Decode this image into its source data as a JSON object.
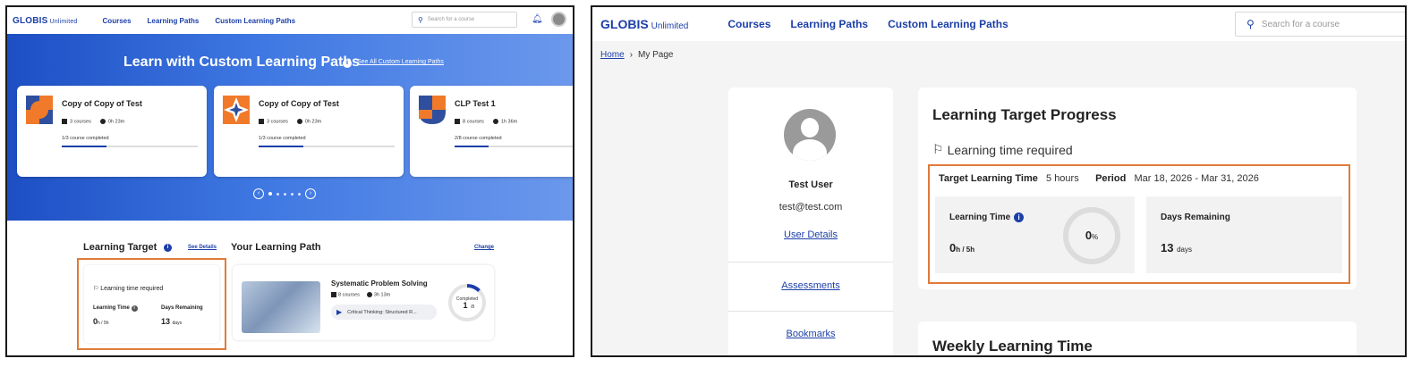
{
  "left": {
    "nav": {
      "logo": "GLOBIS",
      "logo_sub": "Unlimited",
      "links": [
        "Courses",
        "Learning Paths",
        "Custom Learning Paths"
      ],
      "search_placeholder": "Search for a course"
    },
    "hero": {
      "title": "Learn with Custom Learning Paths",
      "link": "See All Custom Learning Paths",
      "cards": [
        {
          "title": "Copy of Copy of Test",
          "courses": "3 courses",
          "time": "0h 23m",
          "completed": "1/3 course completed",
          "progress": 0.33
        },
        {
          "title": "Copy of Copy of Test",
          "courses": "3 courses",
          "time": "0h 23m",
          "completed": "1/3 course completed",
          "progress": 0.33
        },
        {
          "title": "CLP Test 1",
          "courses": "8 courses",
          "time": "1h 36m",
          "completed": "2/8 course completed",
          "progress": 0.25
        }
      ]
    },
    "learning_target": {
      "title": "Learning Target",
      "see_details": "See Details",
      "required": "Learning time required",
      "learning_time_label": "Learning Time",
      "learning_time_value": "0",
      "learning_time_unit": "h / 5h",
      "days_label": "Days Remaining",
      "days_value": "13",
      "days_unit": "days"
    },
    "learning_path": {
      "title": "Your Learning Path",
      "change": "Change",
      "course_title": "Systematic Problem Solving",
      "courses": "8 courses",
      "time": "3h 13m",
      "current": "Critical Thinking: Structured R...",
      "completed_label": "Completed",
      "completed_value": "1",
      "completed_total": "/8",
      "progress": 0.125
    }
  },
  "right": {
    "nav": {
      "logo": "GLOBIS",
      "logo_sub": "Unlimited",
      "links": [
        "Courses",
        "Learning Paths",
        "Custom Learning Paths"
      ],
      "search_placeholder": "Search for a course"
    },
    "breadcrumb": {
      "home": "Home",
      "sep": "›",
      "current": "My Page"
    },
    "profile": {
      "name": "Test User",
      "email": "test@test.com",
      "details": "User Details",
      "menu": [
        "Assessments",
        "Bookmarks"
      ]
    },
    "ltp": {
      "title": "Learning Target Progress",
      "required": "Learning time required",
      "target_label": "Target Learning Time",
      "target_value": "5 hours",
      "period_label": "Period",
      "period_value": "Mar 18, 2026 - Mar 31, 2026",
      "learning_time_label": "Learning Time",
      "learning_time_value": "0",
      "learning_time_unit": "h / 5h",
      "percent_value": "0",
      "percent_unit": "%",
      "days_label": "Days Remaining",
      "days_value": "13",
      "days_unit": "days"
    },
    "weekly": {
      "title": "Weekly Learning Time"
    }
  },
  "colors": {
    "brand": "#1c3fa8",
    "highlight": "#e07a3a"
  }
}
